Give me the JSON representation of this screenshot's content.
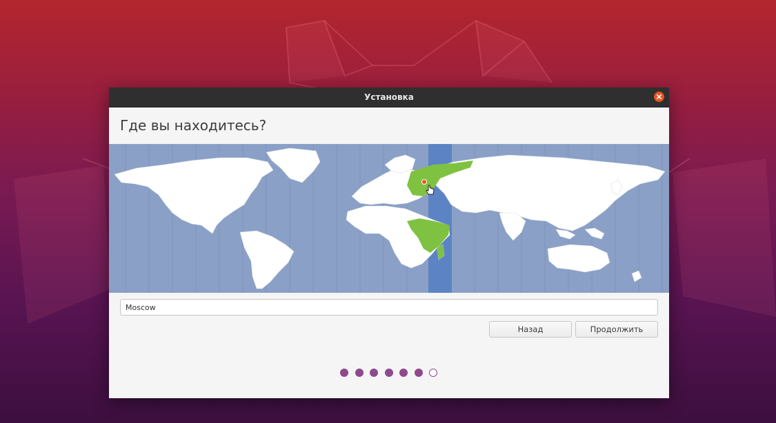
{
  "window": {
    "title": "Установка"
  },
  "page": {
    "heading": "Где вы находитесь?"
  },
  "location": {
    "value": "Moscow",
    "selected_marker_icon": "location-pin-icon",
    "cursor_icon": "hand-pointer-icon"
  },
  "buttons": {
    "back_label": "Назад",
    "continue_label": "Продолжить"
  },
  "progress": {
    "total_steps": 7,
    "completed_steps": 6,
    "active_color": "#8d4a8d"
  },
  "colors": {
    "map_water": "#8aa0c6",
    "map_land": "#ffffff",
    "timezone_highlight": "#7fc241",
    "timezone_band": "#5c84c4",
    "accent": "#e95420"
  }
}
